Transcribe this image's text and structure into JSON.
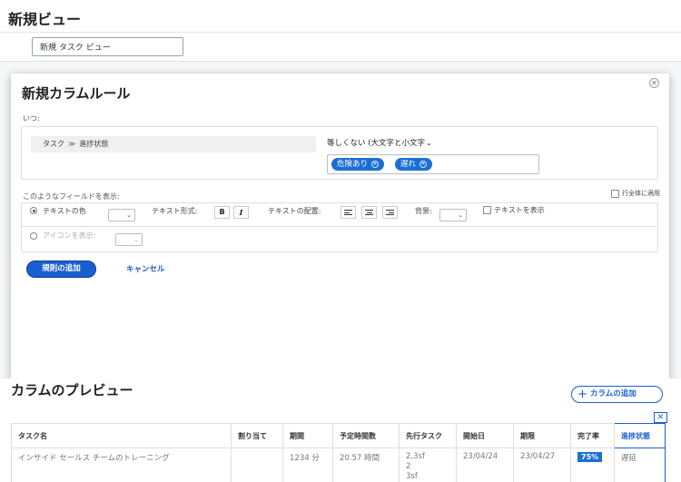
{
  "page": {
    "title": "新規ビュー"
  },
  "view_name": {
    "value": "新規 タスク ビュー"
  },
  "rule_modal": {
    "title": "新規カラムルール",
    "close_icon": "close-circle-icon",
    "when_label": "いつ:",
    "condition": {
      "field_object": "タスク",
      "separator": "≫",
      "field_name": "進捗状態",
      "operator": "等しくない (大文字と小文字",
      "values": [
        "危険あり",
        "遅れ"
      ]
    },
    "fields_label": "このようなフィールドを表示:",
    "entire_row_label": "行全体に適用",
    "format": {
      "text_color_label": "テキストの色",
      "text_style_label": "テキスト形式:",
      "bold_label": "B",
      "italic_label": "I",
      "text_align_label": "テキストの配置:",
      "background_label": "背景:",
      "show_text_label": "テキストを表示",
      "show_icon_label": "アイコンを表示:"
    },
    "add_rule_label": "規則の追加",
    "cancel_label": "キャンセル"
  },
  "preview": {
    "title": "カラムのプレビュー",
    "add_column_label": "カラムの追加",
    "remove_column_label": "✕",
    "columns": [
      "タスク名",
      "割り当て",
      "期間",
      "予定時間数",
      "先行タスク",
      "開始日",
      "期限",
      "完了率",
      "進捗状態"
    ],
    "row": {
      "task_name": "インサイド セールス チームのトレーニング",
      "assigned": "",
      "duration": "1234 分",
      "planned_hours": "20.57 時間",
      "predecessors": [
        "2,3sf",
        "2",
        "3sf"
      ],
      "start_date": "23/04/24",
      "due_date": "23/04/27",
      "percent_complete": "75%",
      "status": "遅延"
    }
  },
  "colors": {
    "accent": "#1a5fd0",
    "pill": "#1b6fd3"
  }
}
